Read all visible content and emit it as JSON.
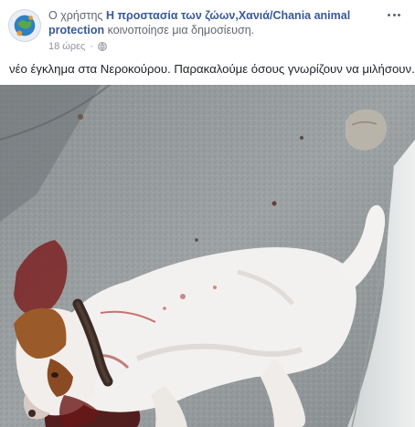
{
  "post": {
    "prefix": "Ο χρήστης",
    "page_name": "Η προστασία των ζώων,Χανιά/Chania animal protection",
    "action_text": "κοινοποίησε μια δημοσίευση.",
    "timestamp": "18 ώρες",
    "separator": "·",
    "audience_icon": "globe-icon",
    "more_icon": "more-options-icon",
    "text": "νέο έγκλημα στα Νεροκούρου. Παρακαλούμε όσους γνωρίζουν να μιλήσουν."
  },
  "colors": {
    "link": "#385898",
    "meta": "#90949c",
    "text": "#1d2129"
  }
}
